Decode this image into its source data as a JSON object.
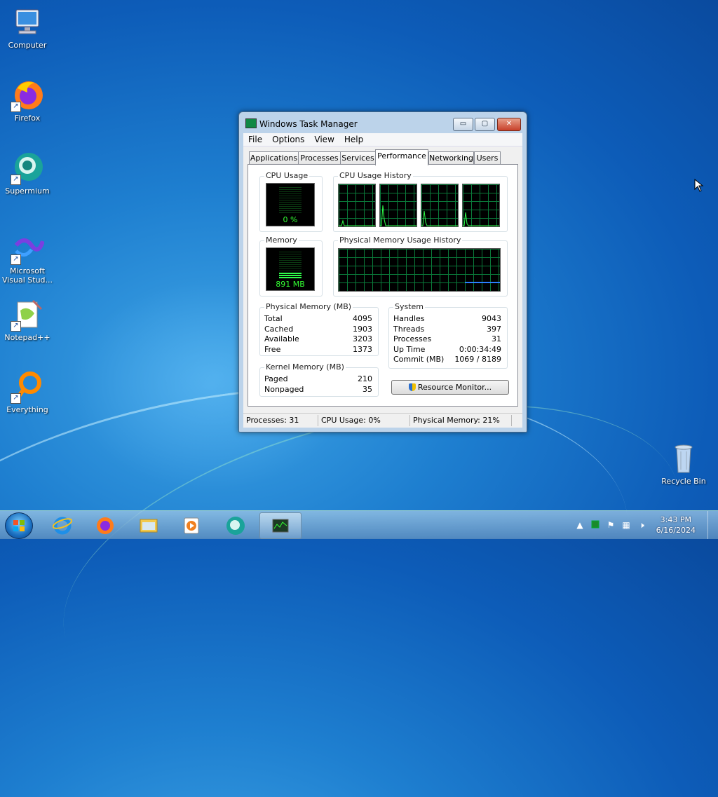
{
  "desktop": {
    "icons": [
      {
        "label": "Computer",
        "icon": "computer-icon"
      },
      {
        "label": "Firefox",
        "icon": "firefox-icon"
      },
      {
        "label": "Supermium",
        "icon": "supermium-icon"
      },
      {
        "label": "Microsoft Visual Stud...",
        "icon": "visual-studio-icon"
      },
      {
        "label": "Notepad++",
        "icon": "notepadpp-icon"
      },
      {
        "label": "Everything",
        "icon": "everything-icon"
      },
      {
        "label": "Recycle Bin",
        "icon": "recycle-bin-icon"
      }
    ]
  },
  "window": {
    "title": "Windows Task Manager",
    "controls": {
      "minimize": "▭",
      "maximize": "▢",
      "close": "✕"
    },
    "menu": [
      "File",
      "Options",
      "View",
      "Help"
    ],
    "tabs": [
      "Applications",
      "Processes",
      "Services",
      "Performance",
      "Networking",
      "Users"
    ],
    "active_tab": "Performance",
    "cpu_usage": {
      "label": "CPU Usage",
      "value": "0 %",
      "fraction": 0.0
    },
    "cpu_history_label": "CPU Usage History",
    "memory": {
      "label": "Memory",
      "value": "891 MB",
      "fraction": 0.22
    },
    "memory_history_label": "Physical Memory Usage History",
    "physical_memory": {
      "label": "Physical Memory (MB)",
      "rows": [
        {
          "k": "Total",
          "v": "4095"
        },
        {
          "k": "Cached",
          "v": "1903"
        },
        {
          "k": "Available",
          "v": "3203"
        },
        {
          "k": "Free",
          "v": "1373"
        }
      ]
    },
    "kernel_memory": {
      "label": "Kernel Memory (MB)",
      "rows": [
        {
          "k": "Paged",
          "v": "210"
        },
        {
          "k": "Nonpaged",
          "v": "35"
        }
      ]
    },
    "system": {
      "label": "System",
      "rows": [
        {
          "k": "Handles",
          "v": "9043"
        },
        {
          "k": "Threads",
          "v": "397"
        },
        {
          "k": "Processes",
          "v": "31"
        },
        {
          "k": "Up Time",
          "v": "0:00:34:49"
        },
        {
          "k": "Commit (MB)",
          "v": "1069 / 8189"
        }
      ]
    },
    "resource_monitor_button": "Resource Monitor...",
    "status": {
      "processes": "Processes: 31",
      "cpu": "CPU Usage: 0%",
      "memory": "Physical Memory: 21%"
    }
  },
  "taskbar": {
    "clock_time": "3:43 PM",
    "clock_date": "6/16/2024",
    "pinned": [
      "internet-explorer-icon",
      "firefox-icon",
      "file-explorer-icon",
      "media-player-icon",
      "supermium-icon",
      "task-manager-icon"
    ],
    "tray_icons": [
      "show-hidden-icons-icon",
      "task-manager-tray-icon",
      "action-center-flag-icon",
      "network-icon",
      "volume-muted-icon"
    ]
  },
  "colors": {
    "graph_green": "#2fff4a",
    "grid_green": "#0a7a3a",
    "memory_line": "#2a7fff",
    "desktop_blue": "#1e7fd0"
  }
}
